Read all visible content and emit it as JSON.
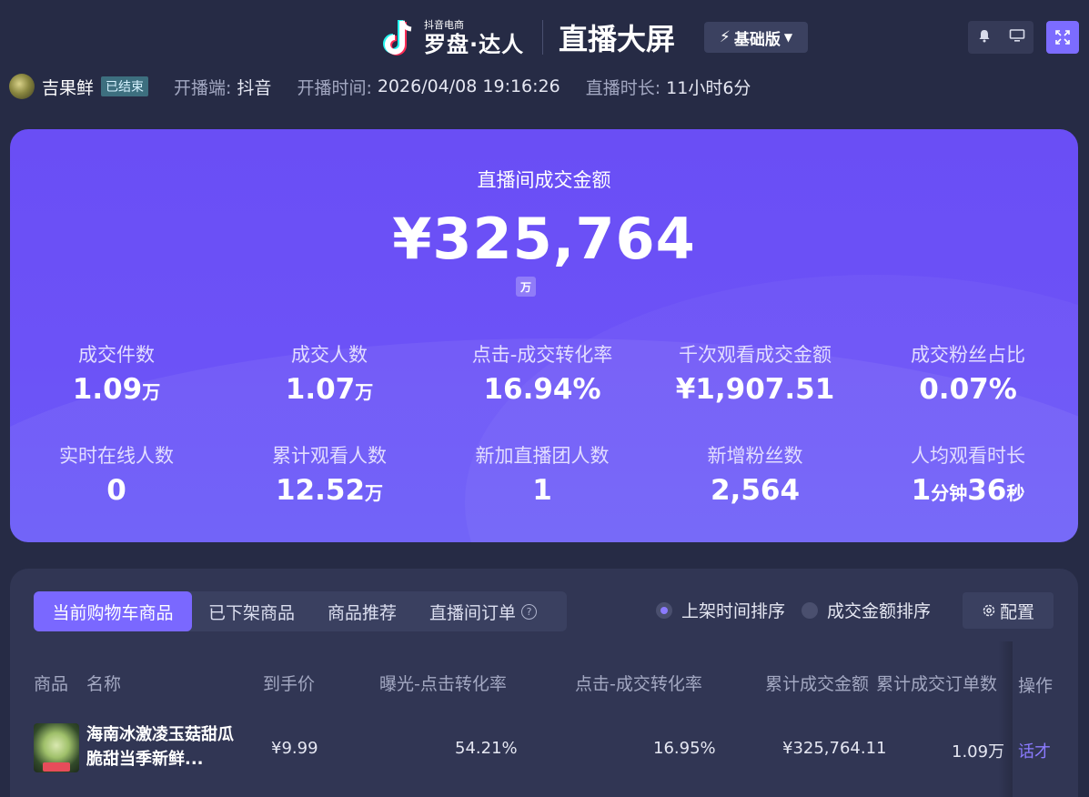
{
  "header": {
    "brand_small": "抖音电商",
    "brand_big": "罗盘·达人",
    "title": "直播大屏",
    "edition": "基础版"
  },
  "info": {
    "streamer": "吉果鲜",
    "status": "已结束",
    "platform_label": "开播端:",
    "platform_value": "抖音",
    "start_label": "开播时间:",
    "start_value": "2026/04/08 19:16:26",
    "duration_label": "直播时长:",
    "duration_value": "11小时6分"
  },
  "hero": {
    "title": "直播间成交金额",
    "value": "¥325,764",
    "unit": "万",
    "metrics": [
      {
        "label": "成交件数",
        "value": "1.09",
        "unit": "万"
      },
      {
        "label": "成交人数",
        "value": "1.07",
        "unit": "万"
      },
      {
        "label": "点击-成交转化率",
        "value": "16.94%",
        "unit": ""
      },
      {
        "label": "千次观看成交金额",
        "value": "¥1,907.51",
        "unit": ""
      },
      {
        "label": "成交粉丝占比",
        "value": "0.07%",
        "unit": ""
      },
      {
        "label": "实时在线人数",
        "value": "0",
        "unit": ""
      },
      {
        "label": "累计观看人数",
        "value": "12.52",
        "unit": "万"
      },
      {
        "label": "新加直播团人数",
        "value": "1",
        "unit": ""
      },
      {
        "label": "新增粉丝数",
        "value": "2,564",
        "unit": ""
      },
      {
        "label": "人均观看时长",
        "value": "",
        "unit": ""
      }
    ],
    "watch_time": {
      "min": "1",
      "min_unit": "分钟",
      "sec": "36",
      "sec_unit": "秒"
    }
  },
  "panel": {
    "tabs": [
      "当前购物车商品",
      "已下架商品",
      "商品推荐",
      "直播间订单"
    ],
    "sort_options": [
      "上架时间排序",
      "成交金额排序"
    ],
    "config_label": "配置",
    "columns": [
      "商品",
      "名称",
      "到手价",
      "曝光-点击转化率",
      "点击-成交转化率",
      "累计成交金额",
      "累计成交订单数",
      "操作"
    ],
    "rows": [
      {
        "name": "海南冰激凌玉菇甜瓜脆甜当季新鲜...",
        "price": "¥9.99",
        "exposure_click": "54.21%",
        "click_deal": "16.95%",
        "gmv": "¥325,764.11",
        "orders": "1.09万",
        "action": "话才"
      }
    ]
  },
  "colors": {
    "background": "#262b45",
    "accent": "#7a68ff",
    "hero_gradient": "#6a4ef5",
    "status_badge": "#3d6f7f"
  }
}
